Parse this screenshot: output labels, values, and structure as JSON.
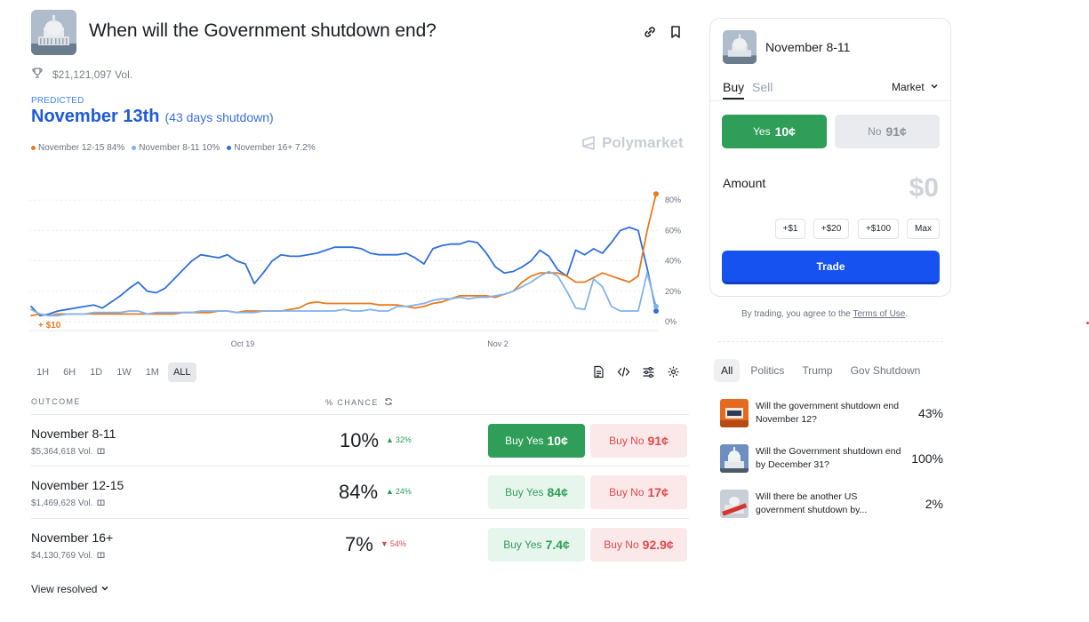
{
  "market": {
    "title": "When will the Government shutdown end?",
    "volume": "$21,121,097 Vol.",
    "predicted_label": "PREDICTED",
    "predicted_value": "November 13th",
    "predicted_sub": "(43 days shutdown)",
    "watermark": "Polymarket"
  },
  "legend": [
    {
      "label": "November 12-15 84%",
      "color": "#e87a1e"
    },
    {
      "label": "November 8-11 10%",
      "color": "#7fb3ee"
    },
    {
      "label": "November 16+ 7.2%",
      "color": "#2f6fdc"
    }
  ],
  "chart_data": {
    "type": "line",
    "x_ticks": [
      "Oct 19",
      "Nov 2"
    ],
    "y_ticks": [
      "0%",
      "20%",
      "40%",
      "60%",
      "80%"
    ],
    "ylim": [
      0,
      90
    ],
    "annotation": "+ $10",
    "series": [
      {
        "color": "#2f6fdc",
        "values": [
          10,
          4,
          5,
          7,
          8,
          9,
          10,
          11,
          9,
          13,
          17,
          22,
          26,
          20,
          19,
          22,
          28,
          34,
          40,
          44,
          43,
          42,
          44,
          40,
          38,
          25,
          32,
          40,
          44,
          43,
          43,
          44,
          45,
          47,
          49,
          49,
          49,
          48,
          45,
          44,
          44,
          44,
          45,
          42,
          38,
          48,
          50,
          51,
          51,
          53,
          52,
          45,
          36,
          32,
          33,
          36,
          40,
          47,
          43,
          34,
          30,
          47,
          44,
          48,
          45,
          52,
          60,
          62,
          60,
          35,
          7
        ]
      },
      {
        "color": "#e87a1e",
        "values": [
          4,
          5,
          4,
          5,
          5,
          5,
          5,
          5,
          5,
          5,
          5,
          5,
          5,
          5,
          5,
          5,
          5,
          6,
          6,
          6,
          6,
          7,
          7,
          6,
          7,
          7,
          7,
          7,
          7,
          8,
          9,
          12,
          13,
          12,
          12,
          12,
          12,
          12,
          12,
          11,
          11,
          11,
          10,
          9,
          10,
          12,
          13,
          15,
          17,
          17,
          17,
          17,
          16,
          18,
          20,
          26,
          30,
          32,
          32,
          32,
          30,
          26,
          26,
          29,
          32,
          30,
          28,
          26,
          30,
          60,
          84
        ]
      },
      {
        "color": "#7fb3ee",
        "values": [
          8,
          5,
          4,
          4,
          5,
          5,
          5,
          6,
          6,
          6,
          6,
          7,
          7,
          5,
          6,
          6,
          6,
          6,
          6,
          7,
          7,
          7,
          7,
          6,
          6,
          6,
          7,
          7,
          7,
          7,
          7,
          7,
          7,
          7,
          7,
          8,
          7,
          7,
          8,
          7,
          7,
          10,
          10,
          11,
          12,
          14,
          15,
          15,
          16,
          15,
          16,
          16,
          17,
          18,
          20,
          23,
          26,
          30,
          33,
          30,
          20,
          9,
          8,
          28,
          23,
          10,
          7,
          7,
          7,
          32,
          10
        ]
      }
    ]
  },
  "ranges": [
    "1H",
    "6H",
    "1D",
    "1W",
    "1M",
    "ALL"
  ],
  "active_range": "ALL",
  "table": {
    "col_outcome": "OUTCOME",
    "col_chance": "% CHANCE",
    "rows": [
      {
        "name": "November 8-11",
        "vol": "$5,364,618 Vol.",
        "pct": "10%",
        "delta": "32%",
        "dir": "up",
        "yes_label": "Buy Yes",
        "yes_price": "10¢",
        "no_label": "Buy No",
        "no_price": "91¢"
      },
      {
        "name": "November 12-15",
        "vol": "$1,469,628 Vol.",
        "pct": "84%",
        "delta": "24%",
        "dir": "up",
        "yes_label": "Buy Yes",
        "yes_price": "84¢",
        "no_label": "Buy No",
        "no_price": "17¢"
      },
      {
        "name": "November 16+",
        "vol": "$4,130,769 Vol.",
        "pct": "7%",
        "delta": "54%",
        "dir": "down",
        "yes_label": "Buy Yes",
        "yes_price": "7.4¢",
        "no_label": "Buy No",
        "no_price": "92.9¢"
      }
    ],
    "view_resolved": "View resolved"
  },
  "panel": {
    "title": "November 8-11",
    "tab_buy": "Buy",
    "tab_sell": "Sell",
    "order_type": "Market",
    "yes_label": "Yes",
    "yes_price": "10¢",
    "no_label": "No",
    "no_price": "91¢",
    "amount_label": "Amount",
    "amount_value": "$0",
    "quick": [
      "+$1",
      "+$20",
      "+$100",
      "Max"
    ],
    "trade": "Trade"
  },
  "terms": {
    "prefix": "By trading, you agree to the ",
    "link": "Terms of Use",
    "suffix": "."
  },
  "related": {
    "tabs": [
      "All",
      "Politics",
      "Trump",
      "Gov Shutdown"
    ],
    "items": [
      {
        "text": "Will the government shutdown end November 12?",
        "pct": "43%"
      },
      {
        "text": "Will the Government shutdown end by December 31?",
        "pct": "100%"
      },
      {
        "text": "Will there be another US government shutdown by...",
        "pct": "2%"
      }
    ]
  }
}
